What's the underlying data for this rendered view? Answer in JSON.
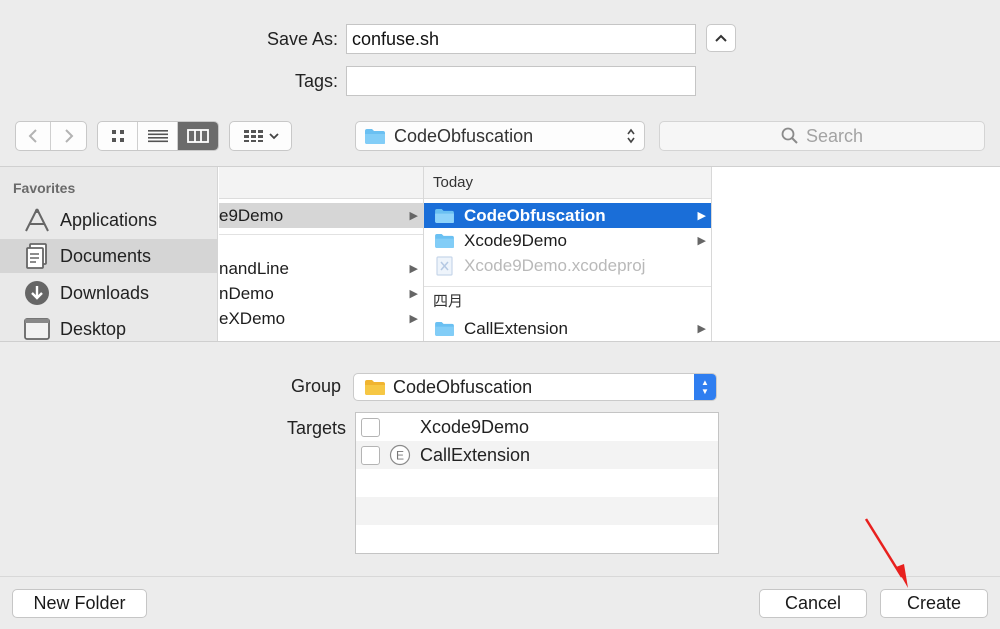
{
  "save_as": {
    "label": "Save As:",
    "value": "confuse.sh"
  },
  "tags": {
    "label": "Tags:",
    "value": ""
  },
  "toolbar": {
    "location": "CodeObfuscation",
    "search_placeholder": "Search"
  },
  "sidebar": {
    "heading": "Favorites",
    "items": [
      {
        "label": "Applications",
        "icon": "applications-icon"
      },
      {
        "label": "Documents",
        "icon": "documents-icon",
        "selected": true
      },
      {
        "label": "Downloads",
        "icon": "downloads-icon"
      },
      {
        "label": "Desktop",
        "icon": "desktop-icon"
      }
    ]
  },
  "column1": {
    "rows": [
      {
        "label": "e9Demo",
        "selected": true
      },
      {
        "label": "nandLine"
      },
      {
        "label": "nDemo"
      },
      {
        "label": "eXDemo"
      }
    ]
  },
  "column2": {
    "header": "Today",
    "rows": [
      {
        "label": "CodeObfuscation",
        "selected": true
      },
      {
        "label": "Xcode9Demo"
      },
      {
        "label": "Xcode9Demo.xcodeproj",
        "dimmed": true
      }
    ],
    "group2_header": "四月",
    "group2_rows": [
      {
        "label": "CallExtension"
      }
    ]
  },
  "group": {
    "label": "Group",
    "value": "CodeObfuscation"
  },
  "targets": {
    "label": "Targets",
    "items": [
      {
        "label": "Xcode9Demo",
        "checked": false
      },
      {
        "label": "CallExtension",
        "checked": false,
        "badge": "E"
      }
    ]
  },
  "buttons": {
    "new_folder": "New Folder",
    "cancel": "Cancel",
    "create": "Create"
  },
  "colors": {
    "selection_blue": "#1a6ed8",
    "folder_blue": "#6ac0f2",
    "folder_yellow": "#f6c744",
    "annotation_arrow": "#e8201e"
  }
}
